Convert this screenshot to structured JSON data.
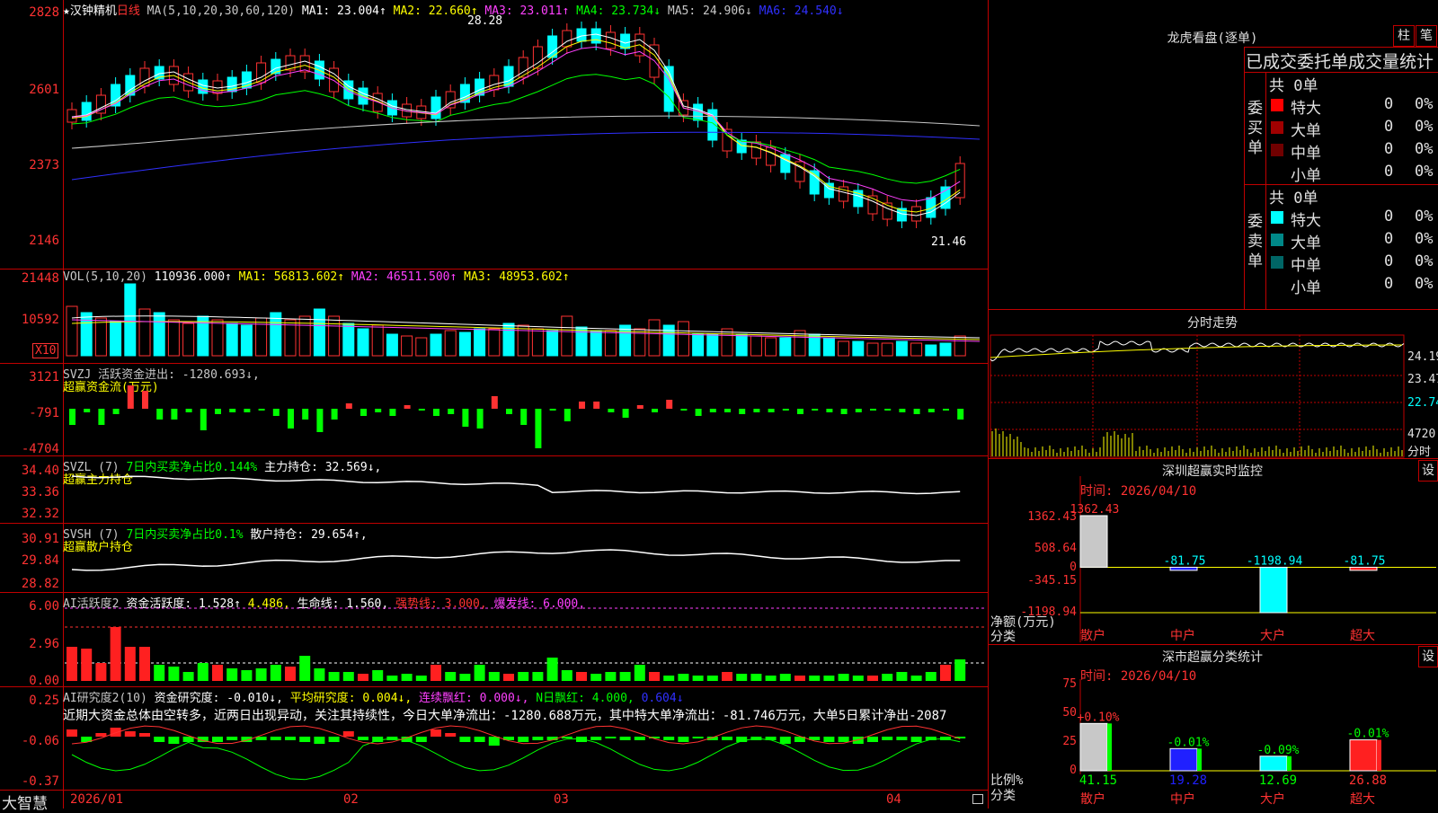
{
  "stock": {
    "title": "★汉钟精机",
    "period": "日线",
    "ma_header": "MA(5,10,20,30,60,120)",
    "ma_values": [
      {
        "label": "MA1: 23.004↑",
        "color": "#ffffff"
      },
      {
        "label": "MA2: 22.660↑",
        "color": "#ffff00"
      },
      {
        "label": "MA3: 23.011↑",
        "color": "#ff40ff"
      },
      {
        "label": "MA4: 23.734↓",
        "color": "#00ff00"
      },
      {
        "label": "MA5: 24.906↓",
        "color": "#c8c8c8"
      },
      {
        "label": "MA6: 24.540↓",
        "color": "#3030ff"
      }
    ],
    "high_label": "28.28",
    "low_label": "21.46",
    "price_axis": [
      "2828",
      "2601",
      "2373",
      "2146"
    ]
  },
  "vol": {
    "header": "VOL(5,10,20)",
    "value": "110936.000↑",
    "ma1": "MA1: 56813.602↑",
    "ma2": "MA2: 46511.500↑",
    "ma3": "MA3: 48953.602↑",
    "axis": [
      "21448",
      "10592"
    ],
    "unit": "X10"
  },
  "svzj": {
    "header": "SVZJ  活跃资金进出: -1280.693↓,",
    "sub": "超赢资金流(万元)",
    "axis": [
      "3121",
      "-791",
      "-4704"
    ]
  },
  "svzl": {
    "header": "SVZL (7)",
    "ratio": "7日内买卖净占比0.144%",
    "hold": "主力持仓: 32.569↓,",
    "sub": "超赢主力持仓",
    "axis": [
      "34.40",
      "33.36",
      "32.32"
    ]
  },
  "svsh": {
    "header": "SVSH (7)",
    "ratio": "7日内买卖净占比0.1%",
    "hold": "散户持仓: 29.654↑,",
    "sub": "超赢散户持仓",
    "axis": [
      "30.91",
      "29.84",
      "28.82"
    ]
  },
  "ai1": {
    "header": "AI活跃度2",
    "act": "资金活跃度: 1.528↑",
    "v2": "4.486,",
    "life": "生命线: 1.560,",
    "strong": "强势线: 3.000,",
    "burst": "爆发线: 6.000,",
    "axis": [
      "6.00",
      "2.96",
      "0.00"
    ]
  },
  "ai2": {
    "header": "AI研究度2(10)",
    "res": "资金研究度: -0.010↓,",
    "avg": "平均研究度: 0.004↓,",
    "cont": "连续飘红: 0.000↓,",
    "nday": "N日飘红: 4.000,",
    "last": "0.604↓",
    "summary": "近期大资金总体由空转多，近两日出现异动，关注其持续性，今日大单净流出：-1280.688万元，其中特大单净流出：-81.746万元，大单5日累计净出-2087",
    "axis": [
      "0.25",
      "-0.06",
      "-0.37"
    ]
  },
  "xaxis": {
    "labels": [
      "2026/01",
      "02",
      "03",
      "04"
    ],
    "brand": "大智慧"
  },
  "longhu": {
    "title": "龙虎看盘(逐单)",
    "btn1": "柱",
    "btn2": "笔",
    "heading": "已成交委托单成交量统计",
    "buy_label": "委买单",
    "sell_label": "委卖单",
    "buy_total": "共 0单",
    "sell_total": "共 0单",
    "buy_rows": [
      {
        "name": "特大",
        "count": "0",
        "pct": "0%",
        "color": "#ff0000"
      },
      {
        "name": "大单",
        "count": "0",
        "pct": "0%",
        "color": "#a00000"
      },
      {
        "name": "中单",
        "count": "0",
        "pct": "0%",
        "color": "#700000"
      },
      {
        "name": "小单",
        "count": "0",
        "pct": "0%",
        "color": ""
      }
    ],
    "sell_rows": [
      {
        "name": "特大",
        "count": "0",
        "pct": "0%",
        "color": "#00ffff"
      },
      {
        "name": "大单",
        "count": "0",
        "pct": "0%",
        "color": "#008888"
      },
      {
        "name": "中单",
        "count": "0",
        "pct": "0%",
        "color": "#006666"
      },
      {
        "name": "小单",
        "count": "0",
        "pct": "0%",
        "color": ""
      }
    ]
  },
  "intraday": {
    "title": "分时走势",
    "axis": [
      "24.19",
      "23.47",
      "22.74",
      "4720",
      "分时"
    ]
  },
  "sz_monitor": {
    "title": "深圳超赢实时监控",
    "btn": "设",
    "time": "时间: 2026/04/10",
    "axis": [
      "1362.43",
      "508.64",
      "0",
      "-345.15",
      "-1198.94"
    ],
    "unit1": "净额(万元)",
    "unit2": "分类",
    "categories": [
      "散户",
      "中户",
      "大户",
      "超大"
    ],
    "values": [
      1362.43,
      -81.75,
      -1198.94,
      -81.75
    ],
    "labels": [
      "1362.43",
      "-81.75",
      "-1198.94",
      "-81.75"
    ]
  },
  "sz_class": {
    "title": "深市超赢分类统计",
    "btn": "设",
    "time": "时间: 2026/04/10",
    "axis": [
      "75",
      "50",
      "25",
      "0"
    ],
    "unit1": "比例%",
    "unit2": "分类",
    "categories": [
      "散户",
      "中户",
      "大户",
      "超大"
    ],
    "values": [
      41.15,
      19.28,
      12.69,
      26.88
    ],
    "values_label": [
      "41.15",
      "19.28",
      "12.69",
      "26.88"
    ],
    "changes": [
      "+0.10%",
      "-0.01%",
      "-0.09%",
      "-0.01%"
    ],
    "colors": [
      "#c8c8c8",
      "#2020ff",
      "#00ffff",
      "#ff2020"
    ]
  }
}
